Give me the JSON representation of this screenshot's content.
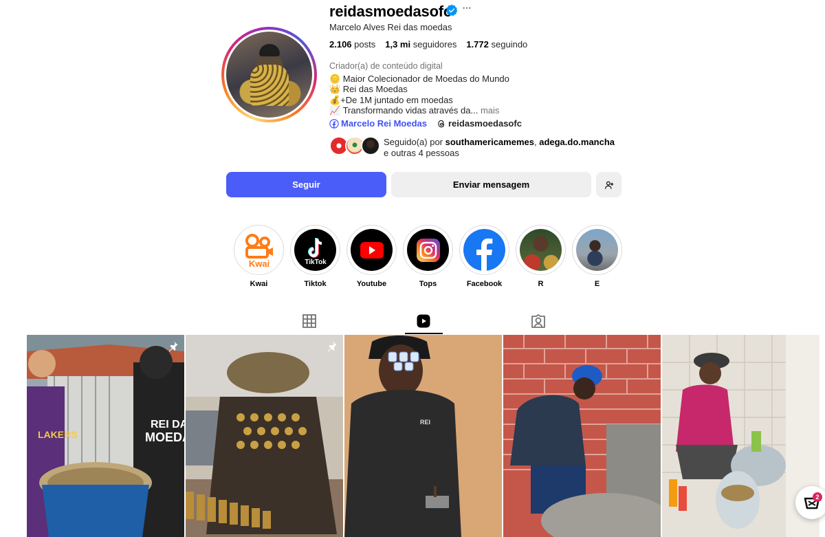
{
  "profile": {
    "username": "reidasmoedasofc",
    "full_name": "Marcelo Alves Rei das moedas",
    "verified": true,
    "stats": {
      "posts_value": "2.106",
      "posts_label": "posts",
      "followers_value": "1,3 mi",
      "followers_label": "seguidores",
      "following_value": "1.772",
      "following_label": "seguindo"
    },
    "category": "Criador(a) de conteúdo digital",
    "bio_lines": [
      "🪙 Maior Colecionador de Moedas do Mundo",
      "👑 Rei das Moedas",
      "💰+De 1M juntado em moedas",
      "📈 Transformando vidas através da..."
    ],
    "bio_more": "mais",
    "link_facebook": "Marcelo Rei Moedas",
    "link_threads": "reidasmoedasofc",
    "followed_by_prefix": "Seguido(a) por",
    "followed_by_user1": "southamericamemes",
    "followed_by_sep": ",",
    "followed_by_user2": "adega.do.mancha",
    "followed_by_suffix": "e outras 4 pessoas"
  },
  "actions": {
    "follow_label": "Seguir",
    "message_label": "Enviar mensagem"
  },
  "highlights": [
    {
      "label": "Kwai"
    },
    {
      "label": "Tiktok"
    },
    {
      "label": "Youtube"
    },
    {
      "label": "Tops"
    },
    {
      "label": "Facebook"
    },
    {
      "label": "R"
    },
    {
      "label": "E"
    }
  ],
  "tabs": [
    {
      "icon": "grid-icon",
      "active": false
    },
    {
      "icon": "reels-icon",
      "active": true
    },
    {
      "icon": "tagged-icon",
      "active": false
    }
  ],
  "cart": {
    "badge_count": "2"
  },
  "colors": {
    "follow_button": "#4a5df9",
    "link_blue": "#4150f7",
    "verified_blue": "#0095f6",
    "secondary_button": "#efefef"
  }
}
